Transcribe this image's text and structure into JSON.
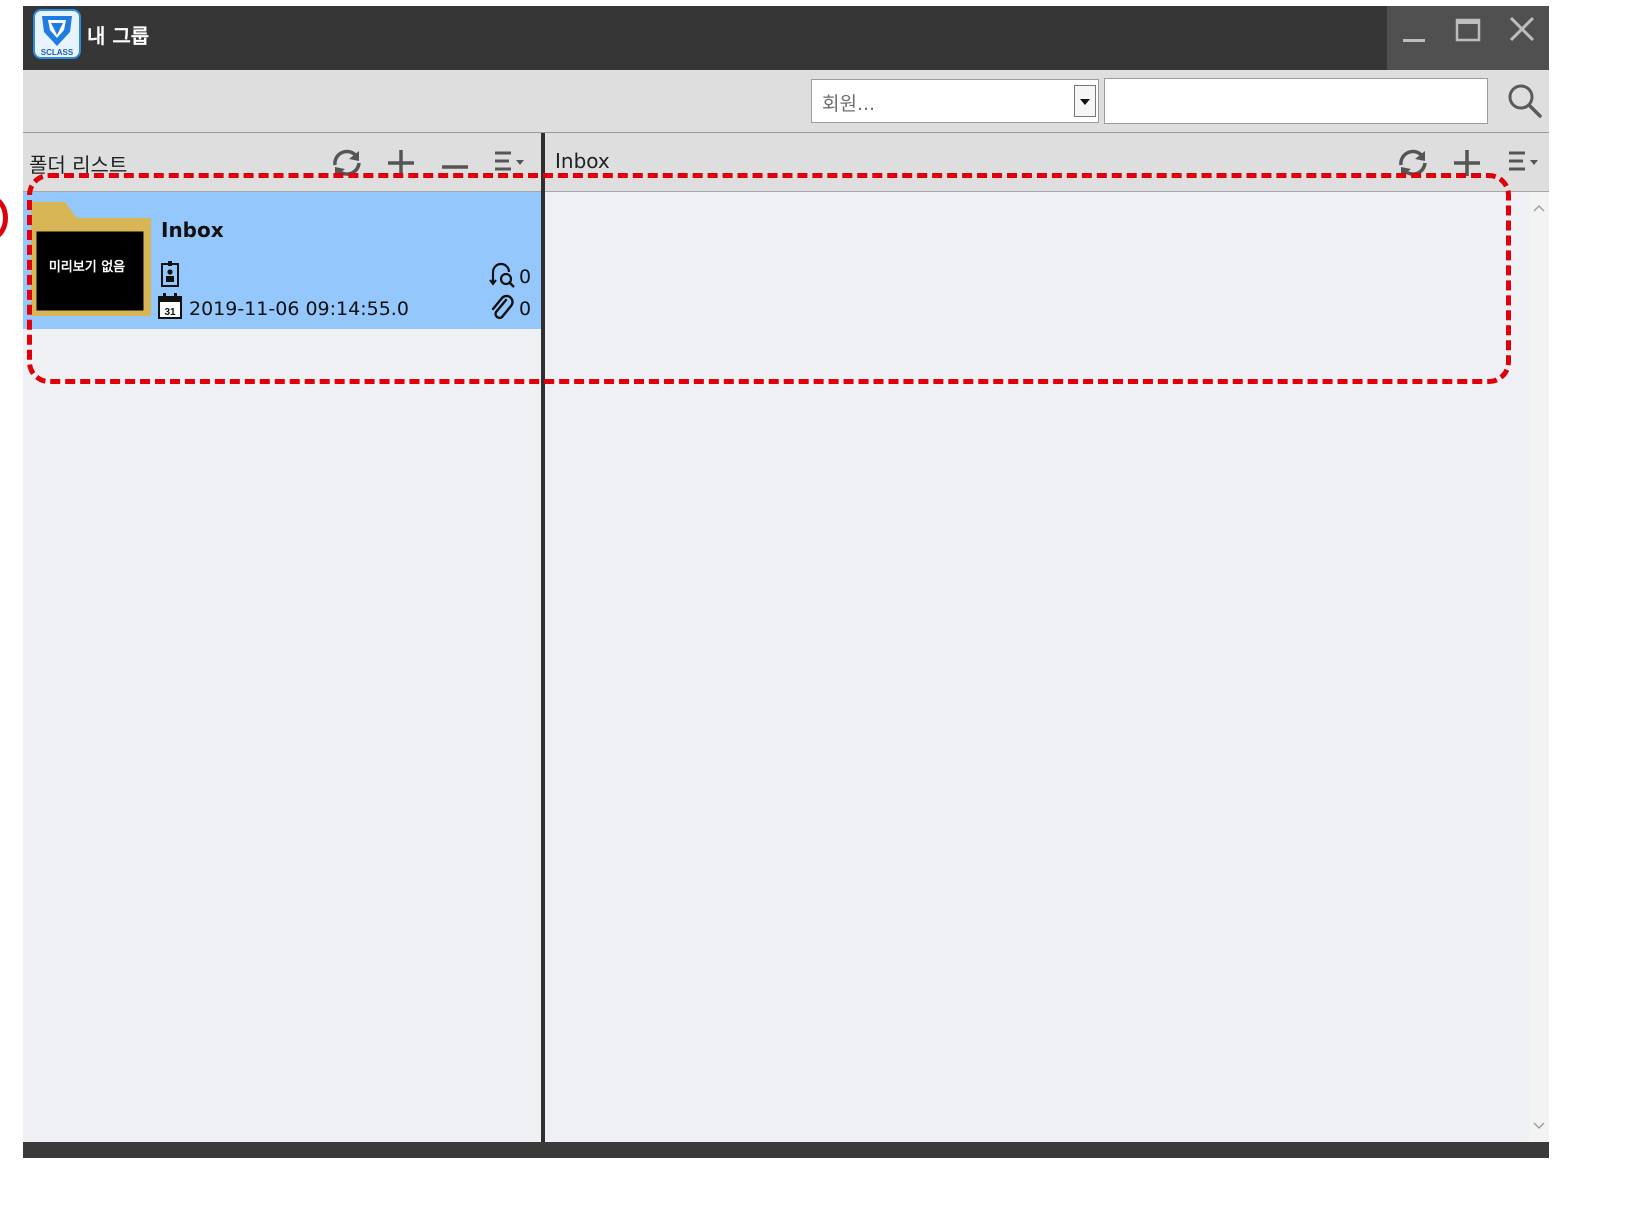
{
  "window": {
    "title": "내 그룹",
    "logo_text": "SCLASS",
    "controls": [
      "minimize-icon",
      "maximize-icon",
      "close-icon"
    ]
  },
  "toolbar": {
    "member_select": {
      "value": "회원..."
    },
    "search_input": {
      "value": ""
    },
    "search_icon": "search-icon"
  },
  "left_panel": {
    "title": "폴더 리스트",
    "actions": [
      "refresh-icon",
      "add-icon",
      "remove-icon",
      "menu-icon"
    ],
    "folders": [
      {
        "thumbnail_label": "미리보기 없음",
        "name": "Inbox",
        "date": "2019-11-06 09:14:55.0",
        "views": "0",
        "attachments": "0"
      }
    ]
  },
  "right_panel": {
    "title": "Inbox",
    "actions": [
      "refresh-icon",
      "add-icon",
      "menu-icon"
    ]
  },
  "colors": {
    "titlebar": "#363636",
    "selection": "#94c7fb",
    "annotation": "#e0000c",
    "folder": "#d8b655"
  }
}
